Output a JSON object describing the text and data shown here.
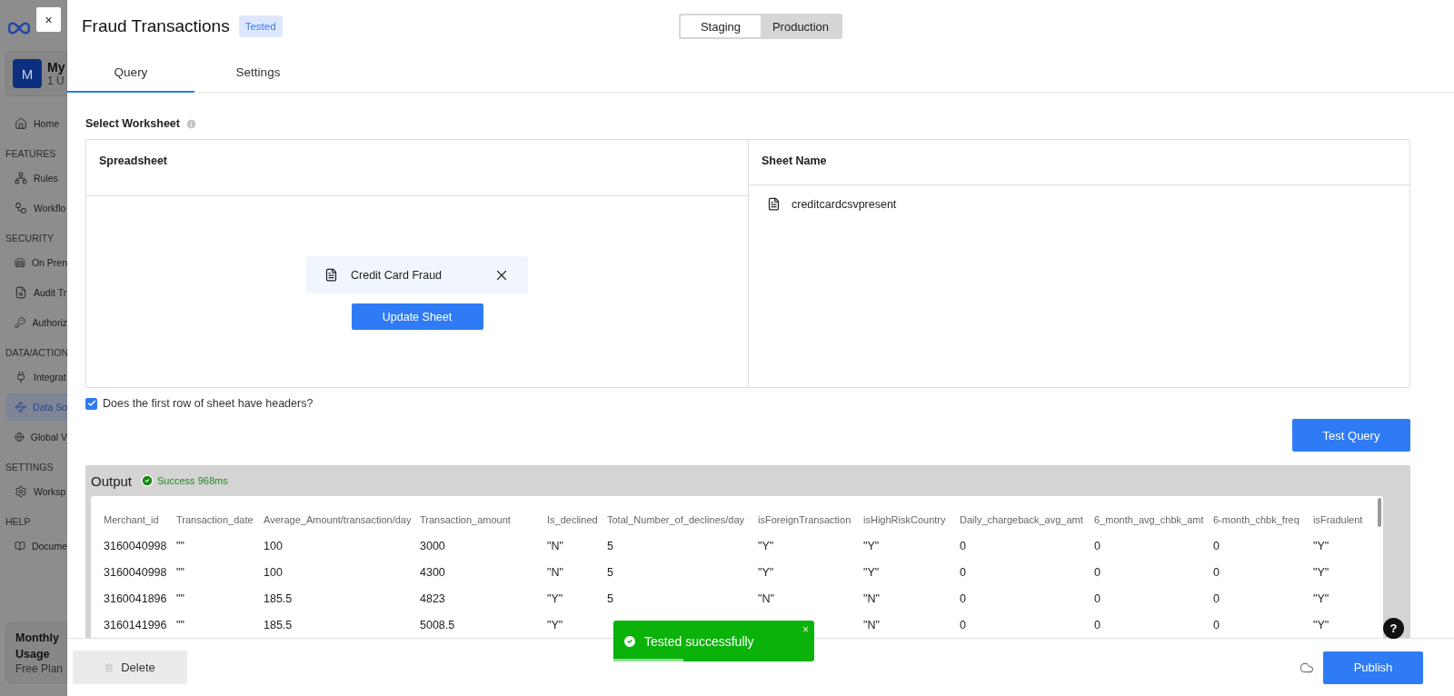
{
  "sidebar": {
    "workspace": {
      "initial": "M",
      "name": "My",
      "subtitle": "1 U"
    },
    "sections": [
      {
        "items": [
          {
            "label": "Home",
            "selected": false
          }
        ]
      },
      {
        "heading": "FEATURES",
        "items": [
          {
            "label": "Rules",
            "selected": false
          },
          {
            "label": "Workflo",
            "selected": false
          }
        ]
      },
      {
        "heading": "SECURITY",
        "items": [
          {
            "label": "On Pren",
            "selected": false
          },
          {
            "label": "Audit Tr",
            "selected": false
          },
          {
            "label": "Authoriz",
            "selected": false
          }
        ]
      },
      {
        "heading": "DATA/ACTION",
        "items": [
          {
            "label": "Integrat",
            "selected": false
          },
          {
            "label": "Data So",
            "selected": true
          },
          {
            "label": "Global V",
            "selected": false
          }
        ]
      },
      {
        "heading": "SETTINGS",
        "items": [
          {
            "label": "Worksp",
            "selected": false
          }
        ]
      },
      {
        "heading": "HELP",
        "items": [
          {
            "label": "Docume",
            "selected": false
          }
        ]
      }
    ],
    "usage": {
      "title": "Monthly Usage",
      "plan": "Free Plan"
    }
  },
  "close_button": "×",
  "title": "Fraud Transactions",
  "badge": "Tested",
  "environments": [
    {
      "label": "Staging",
      "selected": true
    },
    {
      "label": "Production",
      "selected": false
    }
  ],
  "tabs": [
    {
      "label": "Query",
      "selected": true
    },
    {
      "label": "Settings",
      "selected": false
    }
  ],
  "worksheet": {
    "label": "Select Worksheet",
    "spreadsheet_header": "Spreadsheet",
    "sheet_name_header": "Sheet Name",
    "file": "Credit Card Fraud",
    "update_button": "Update Sheet",
    "sheets": [
      {
        "name": "creditcardcsvpresent"
      }
    ]
  },
  "headers_checkbox": {
    "label": "Does the first row of sheet have headers?",
    "checked": true
  },
  "test_button": "Test Query",
  "output": {
    "title": "Output",
    "status": "Success 968ms",
    "columns": [
      "Merchant_id",
      "Transaction_date",
      "Average_Amount/transaction/day",
      "Transaction_amount",
      "Is_declined",
      "Total_Number_of_declines/day",
      "isForeignTransaction",
      "isHighRiskCountry",
      "Daily_chargeback_avg_amt",
      "6_month_avg_chbk_amt",
      "6-month_chbk_freq",
      "isFradulent"
    ],
    "rows": [
      [
        "3160040998",
        "\"\"",
        "100",
        "3000",
        "\"N\"",
        "5",
        "\"Y\"",
        "\"Y\"",
        "0",
        "0",
        "0",
        "\"Y\""
      ],
      [
        "3160040998",
        "\"\"",
        "100",
        "4300",
        "\"N\"",
        "5",
        "\"Y\"",
        "\"Y\"",
        "0",
        "0",
        "0",
        "\"Y\""
      ],
      [
        "3160041896",
        "\"\"",
        "185.5",
        "4823",
        "\"Y\"",
        "5",
        "\"N\"",
        "\"N\"",
        "0",
        "0",
        "0",
        "\"Y\""
      ],
      [
        "3160141996",
        "\"\"",
        "185.5",
        "5008.5",
        "\"Y\"",
        null,
        null,
        "\"N\"",
        "0",
        "0",
        "0",
        "\"Y\""
      ]
    ]
  },
  "toast": {
    "message": "Tested successfully",
    "close": "×",
    "level": 0.35
  },
  "help": "?",
  "delete_button": "Delete",
  "publish_button": "Publish"
}
